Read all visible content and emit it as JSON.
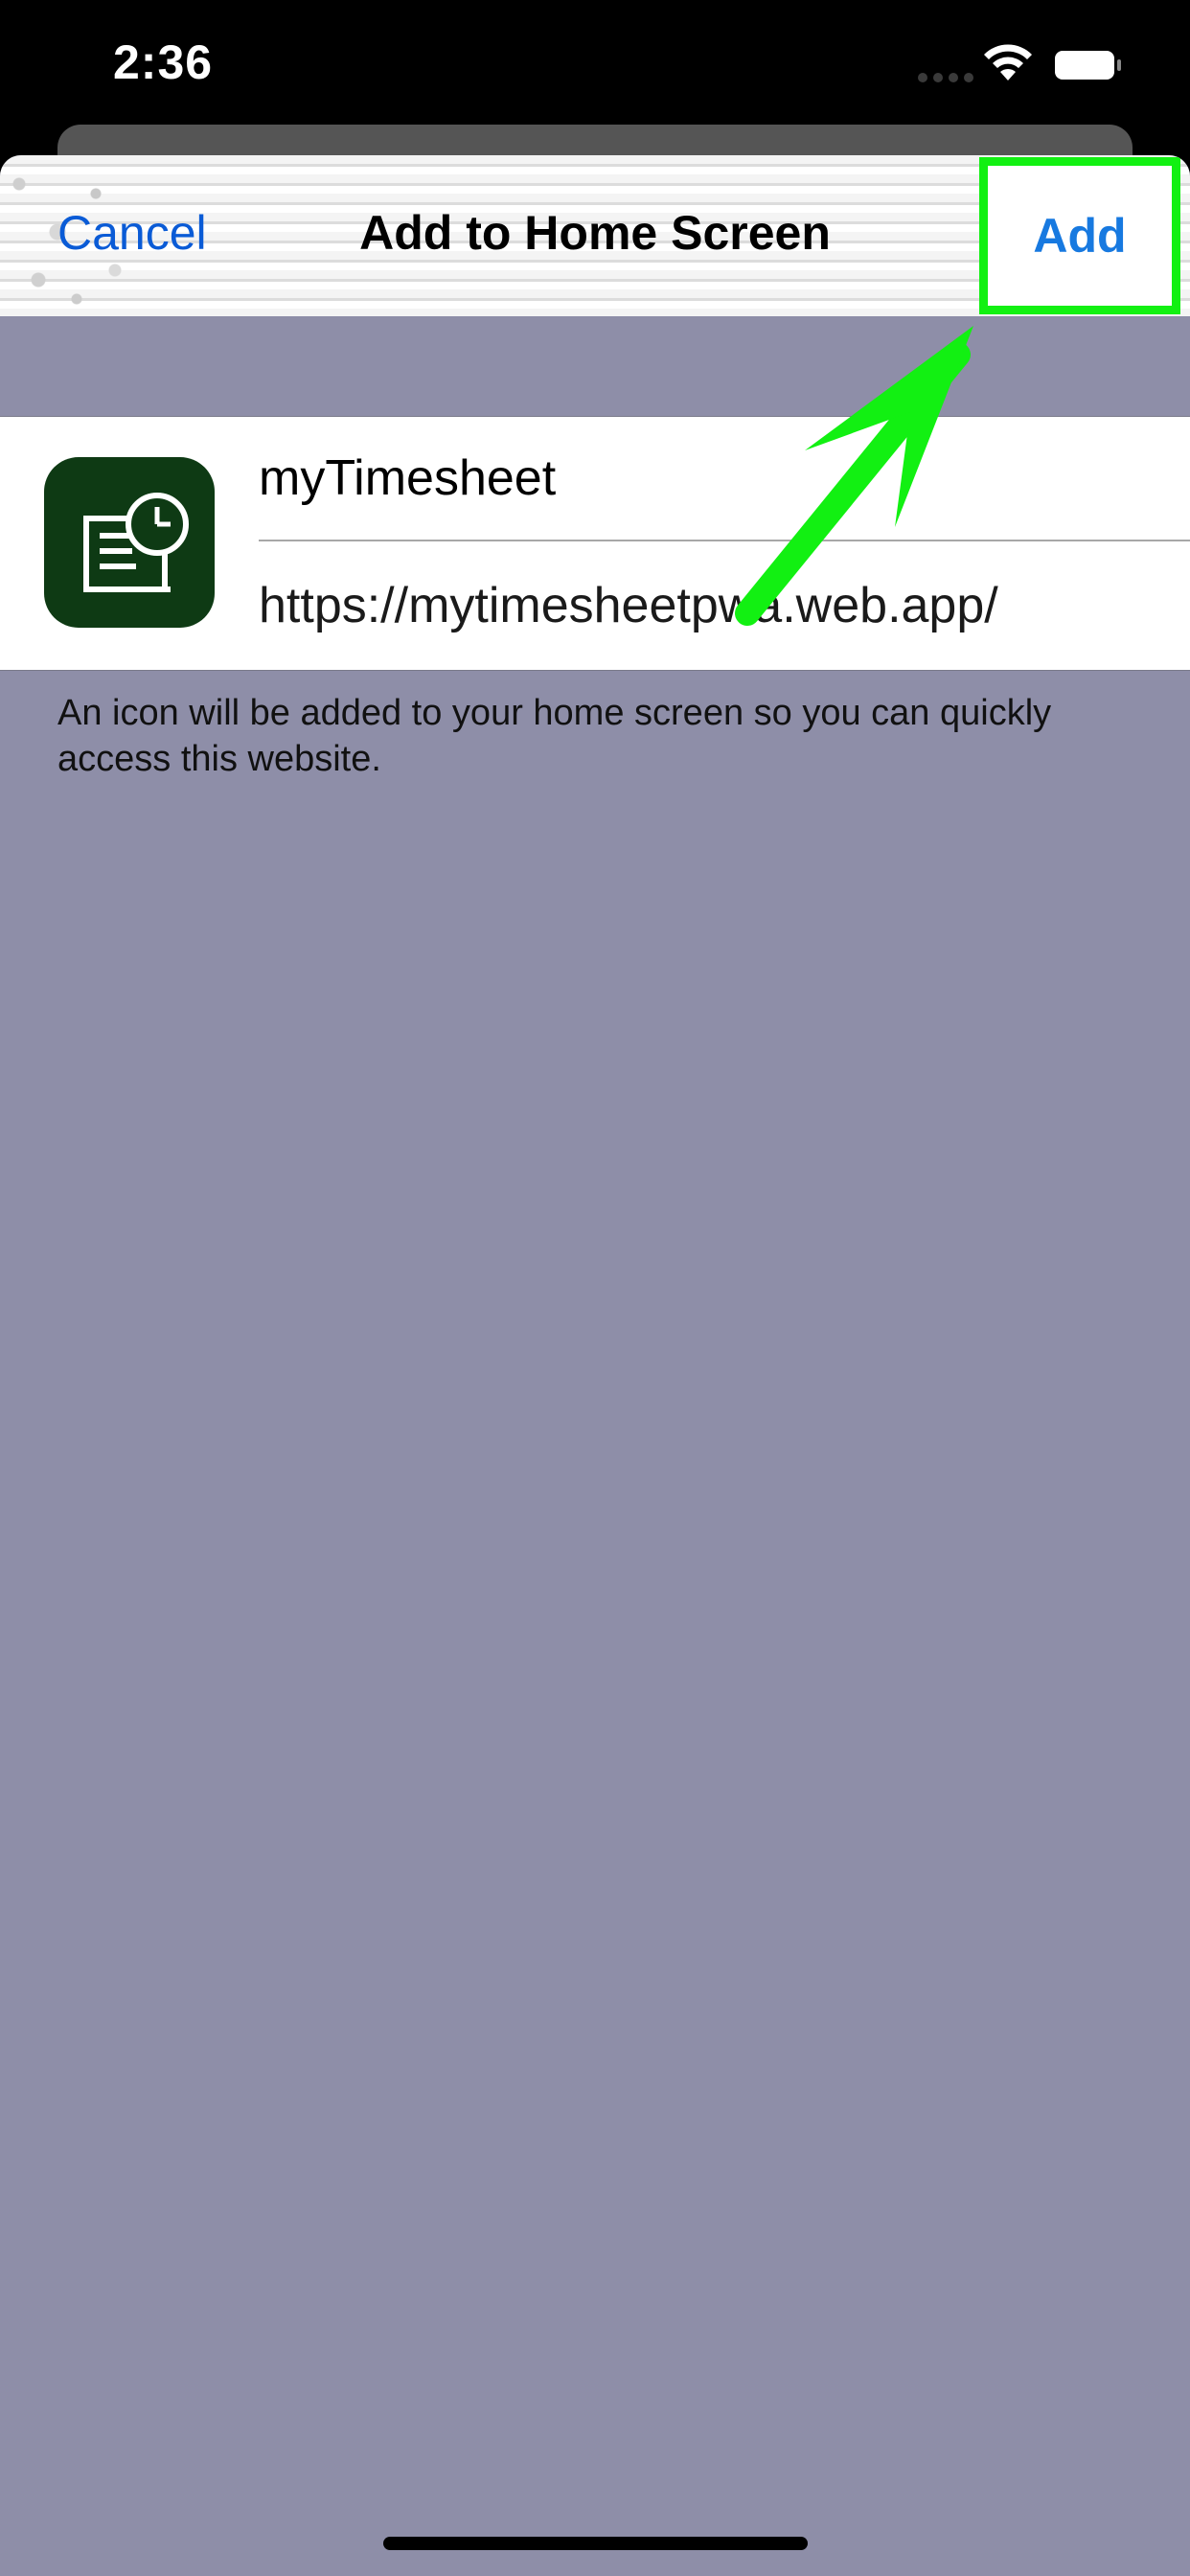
{
  "status_bar": {
    "time": "2:36"
  },
  "nav": {
    "cancel_label": "Cancel",
    "title": "Add to Home Screen",
    "add_label": "Add"
  },
  "app": {
    "name": "myTimesheet",
    "url": "https://mytimesheetpwa.web.app/",
    "icon": "timesheet-clock-icon"
  },
  "info": {
    "text": "An icon will be added to your home screen so you can quickly access this website."
  },
  "colors": {
    "accent": "#1779e0",
    "highlight": "#12f012",
    "sheet_bg": "#8e8ea8",
    "app_icon_bg": "#0e3a14"
  }
}
